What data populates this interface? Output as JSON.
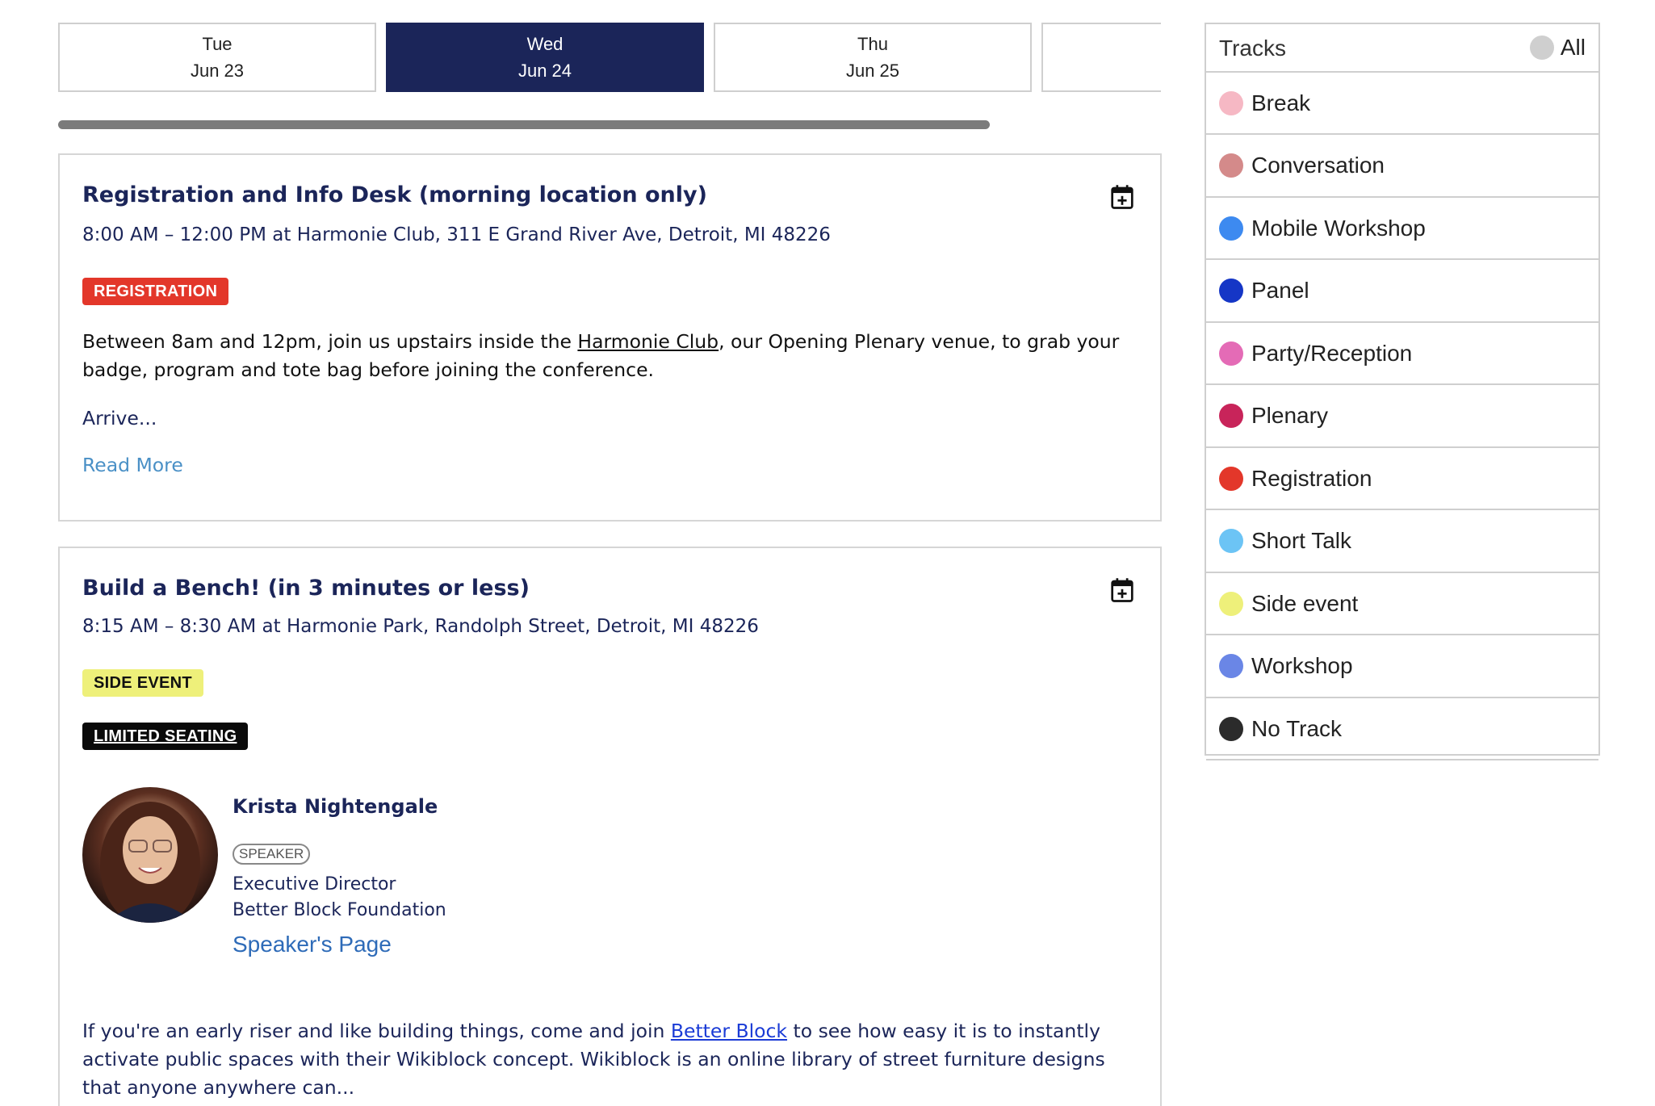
{
  "days": [
    {
      "weekday": "Tue",
      "date": "Jun 23"
    },
    {
      "weekday": "Wed",
      "date": "Jun 24"
    },
    {
      "weekday": "Thu",
      "date": "Jun 25"
    }
  ],
  "sessions": [
    {
      "title": "Registration and Info Desk (morning location only)",
      "time": "8:00 AM – 12:00 PM",
      "location": "at Harmonie Club, 311 E Grand River Ave, Detroit, MI 48226",
      "badges": [
        "REGISTRATION"
      ],
      "description": {
        "before": "Between 8am and 12pm, join us upstairs inside the ",
        "link": "Harmonie Club",
        "after": ", our Opening Plenary venue, to grab your badge, program and tote bag before joining the conference."
      },
      "arrive": "Arrive...",
      "read_more": "Read More"
    },
    {
      "title": "Build a Bench! (in 3 minutes or less)",
      "time": "8:15 AM – 8:30 AM",
      "location": "at Harmonie Park, Randolph Street, Detroit, MI 48226",
      "badges": [
        "SIDE EVENT",
        "LIMITED SEATING"
      ],
      "speaker": {
        "name": "Krista Nightengale",
        "role": "SPEAKER",
        "title": "Executive Director",
        "org": "Better Block Foundation",
        "link": "Speaker's Page"
      },
      "description": {
        "before": "If you're an early riser and like building things, come and join ",
        "link": "Better Block",
        "after": " to see how easy it is to instantly activate public spaces with their Wikiblock concept. Wikiblock is an online library of street furniture designs that anyone anywhere can..."
      }
    }
  ],
  "tracks": {
    "title": "Tracks",
    "all_label": "All",
    "items": [
      {
        "label": "Break",
        "color": "#f6b8c4"
      },
      {
        "label": "Conversation",
        "color": "#d48a8a"
      },
      {
        "label": "Mobile Workshop",
        "color": "#3d8af0"
      },
      {
        "label": "Panel",
        "color": "#1536c6"
      },
      {
        "label": "Party/Reception",
        "color": "#e46bb6"
      },
      {
        "label": "Plenary",
        "color": "#c8245a"
      },
      {
        "label": "Registration",
        "color": "#e3372a"
      },
      {
        "label": "Short Talk",
        "color": "#6cc4f5"
      },
      {
        "label": "Side event",
        "color": "#eef07a"
      },
      {
        "label": "Workshop",
        "color": "#6a86e6"
      },
      {
        "label": "No Track",
        "color": "#2b2b2b"
      }
    ]
  }
}
